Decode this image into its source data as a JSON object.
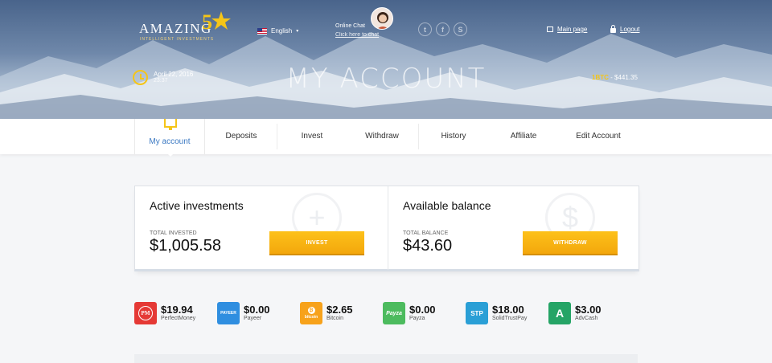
{
  "header": {
    "logo": {
      "word": "AMAZING",
      "numeral": "5",
      "tagline": "INTELLIGENT INVESTMENTS"
    },
    "language": {
      "flag": "us-flag-icon",
      "label": "English"
    },
    "chat": {
      "title": "Online Chat",
      "link": "Click here to chat"
    },
    "social": [
      "twitter-icon",
      "facebook-icon",
      "skype-icon"
    ],
    "main_page": "Main page",
    "logout": "Logout",
    "date": "April 22, 2016",
    "time": "23:37",
    "page_title": "MY ACCOUNT",
    "ticker": {
      "symbol": "1BTC",
      "price": "- $441.35"
    }
  },
  "nav": {
    "items": [
      {
        "label": "My account",
        "active": true
      },
      {
        "label": "Deposits"
      },
      {
        "label": "Invest"
      },
      {
        "label": "Withdraw"
      },
      {
        "label": "History"
      },
      {
        "label": "Affiliate"
      },
      {
        "label": "Edit Account"
      }
    ]
  },
  "summary": {
    "investments": {
      "heading": "Active investments",
      "caption": "TOTAL INVESTED",
      "amount": "$1,005.58",
      "button": "INVEST"
    },
    "balance": {
      "heading": "Available balance",
      "caption": "TOTAL BALANCE",
      "amount": "$43.60",
      "button": "WITHDRAW"
    }
  },
  "wallets": [
    {
      "amount": "$19.94",
      "name": "PerfectMoney",
      "icon_text": "PM",
      "color": "#e53935"
    },
    {
      "amount": "$0.00",
      "name": "Payeer",
      "icon_text": "PAYEER",
      "color": "#2f8ee0"
    },
    {
      "amount": "$2.65",
      "name": "Bitcoin",
      "icon_text": "bitcoin",
      "color": "#f7a21b"
    },
    {
      "amount": "$0.00",
      "name": "Payza",
      "icon_text": "Payza",
      "color": "#4cbb5e"
    },
    {
      "amount": "$18.00",
      "name": "SolidTrustPay",
      "icon_text": "STP",
      "color": "#2a9fd6"
    },
    {
      "amount": "$3.00",
      "name": "AdvCash",
      "icon_text": "A",
      "color": "#25a466"
    }
  ],
  "colors": {
    "accent": "#f5c518",
    "nav_active": "#3a78c2",
    "button": "#f8b313"
  }
}
